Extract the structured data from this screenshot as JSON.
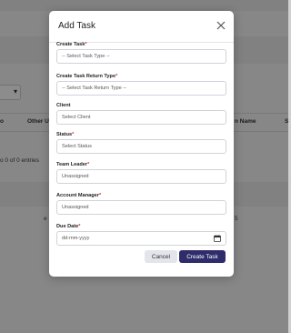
{
  "background": {
    "partial_header_other": "Other Us",
    "partial_header_name": "n Name",
    "partial_header_s": "S",
    "partial_header_left": "o",
    "entries_text": "o 0 of 0 entries",
    "partial_e": "e",
    "partial_5": "5"
  },
  "modal": {
    "title": "Add Task",
    "fields": {
      "create_task": {
        "label": "Create Task",
        "required": "*",
        "placeholder": "-- Select Task Type --"
      },
      "return_type": {
        "label": "Create Task Return Type",
        "required": "*",
        "placeholder": "-- Select Task Return Type --"
      },
      "client": {
        "label": "Client",
        "placeholder": "Select Client"
      },
      "status": {
        "label": "Status",
        "required": "*",
        "placeholder": "Select Status"
      },
      "team_leader": {
        "label": "Team Leader",
        "required": "*",
        "value": "Unassigned"
      },
      "account_manager": {
        "label": "Account Manager",
        "required": "*",
        "value": "Unassigned"
      },
      "due_date": {
        "label": "Due Date",
        "required": "*",
        "placeholder": "dd-mm-yyyy"
      }
    },
    "buttons": {
      "cancel": "Cancel",
      "create": "Create Task"
    }
  },
  "colors": {
    "primary": "#2e2c6b",
    "required": "#d93025",
    "overlay": "rgba(0,0,0,0.45)"
  }
}
